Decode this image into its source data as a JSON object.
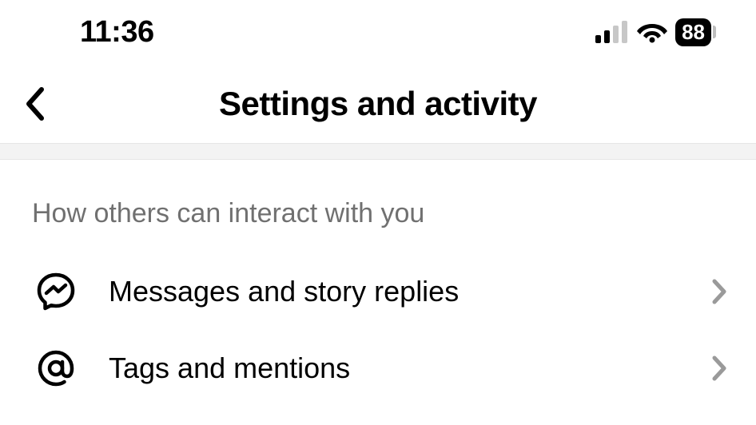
{
  "status": {
    "time": "11:36",
    "battery": "88"
  },
  "header": {
    "title": "Settings and activity"
  },
  "section": {
    "title": "How others can interact with you",
    "items": [
      {
        "icon": "messenger-icon",
        "label": "Messages and story replies"
      },
      {
        "icon": "at-icon",
        "label": "Tags and mentions"
      }
    ]
  }
}
